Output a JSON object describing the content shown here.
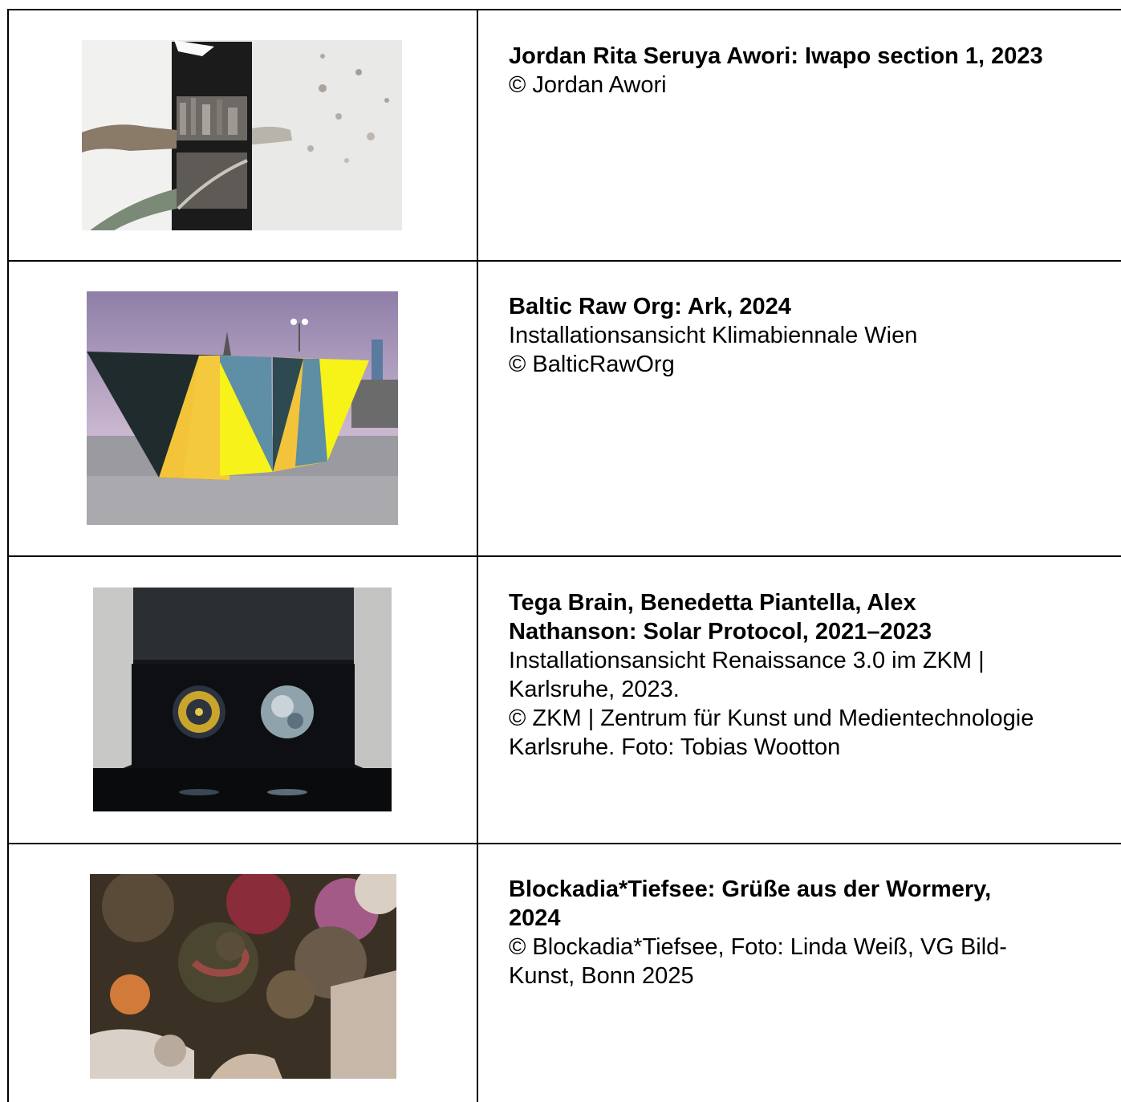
{
  "rows": [
    {
      "image_label": "Iwapo section 1 artwork photo",
      "title": "Jordan Rita Seruya Awori: Iwapo section 1, 2023",
      "lines": [
        "© Jordan Awori"
      ]
    },
    {
      "image_label": "Ark installation photo",
      "title": "Baltic Raw Org: Ark, 2024",
      "lines": [
        "Installationsansicht Klimabiennale Wien",
        "© BalticRawOrg"
      ]
    },
    {
      "image_label": "Solar Protocol installation photo",
      "title_lines": [
        "Tega Brain, Benedetta Piantella, Alex",
        "Nathanson: Solar Protocol, 2021–2023"
      ],
      "lines": [
        "Installationsansicht Renaissance 3.0 im ZKM |",
        "Karlsruhe, 2023.",
        "© ZKM | Zentrum für Kunst und Medientechnologie",
        "Karlsruhe. Foto: Tobias Wootton"
      ]
    },
    {
      "image_label": "Grüße aus der Wormery photo",
      "title_lines": [
        "Blockadia*Tiefsee: Grüße aus der Wormery,",
        "2024"
      ],
      "lines": [
        "© Blockadia*Tiefsee, Foto: Linda Weiß, VG Bild-",
        "Kunst, Bonn 2025"
      ]
    }
  ]
}
